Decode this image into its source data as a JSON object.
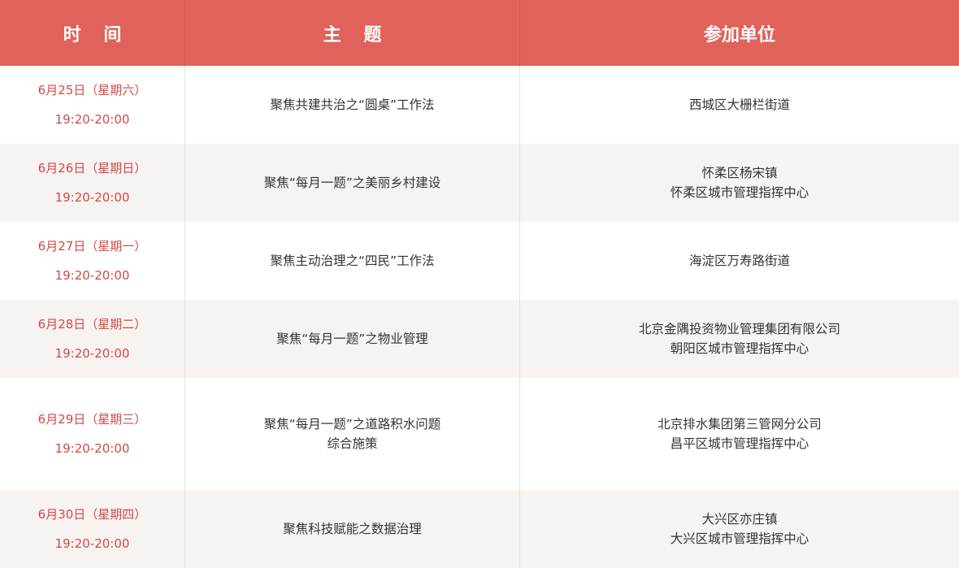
{
  "header": {
    "time": "时 间",
    "topic": "主 题",
    "unit": "参加单位"
  },
  "rows": [
    {
      "date": "6月25日（星期六）",
      "time": "19:20-20:00",
      "topic": [
        "聚焦共建共治之“圆桌”工作法"
      ],
      "units": [
        "西城区大栅栏街道"
      ]
    },
    {
      "date": "6月26日（星期日）",
      "time": "19:20-20:00",
      "topic": [
        "聚焦“每月一题”之美丽乡村建设"
      ],
      "units": [
        "怀柔区杨宋镇",
        "怀柔区城市管理指挥中心"
      ]
    },
    {
      "date": "6月27日（星期一）",
      "time": "19:20-20:00",
      "topic": [
        "聚焦主动治理之“四民”工作法"
      ],
      "units": [
        "海淀区万寿路街道"
      ]
    },
    {
      "date": "6月28日（星期二）",
      "time": "19:20-20:00",
      "topic": [
        "聚焦“每月一题”之物业管理"
      ],
      "units": [
        "北京金隅投资物业管理集团有限公司",
        "朝阳区城市管理指挥中心"
      ]
    },
    {
      "date": "6月29日（星期三）",
      "time": "19:20-20:00",
      "topic": [
        "聚焦“每月一题”之道路积水问题",
        "综合施策"
      ],
      "units": [
        "北京排水集团第三管网分公司",
        "昌平区城市管理指挥中心"
      ]
    },
    {
      "date": "6月30日（星期四）",
      "time": "19:20-20:00",
      "topic": [
        "聚焦科技赋能之数据治理"
      ],
      "units": [
        "大兴区亦庄镇",
        "大兴区城市管理指挥中心"
      ]
    }
  ],
  "colors": {
    "header_bg": "#e0625b",
    "header_text": "#ffffff",
    "date_text": "#cf4a44",
    "body_text": "#333333",
    "alt_row_bg": "#f7f3f1"
  }
}
